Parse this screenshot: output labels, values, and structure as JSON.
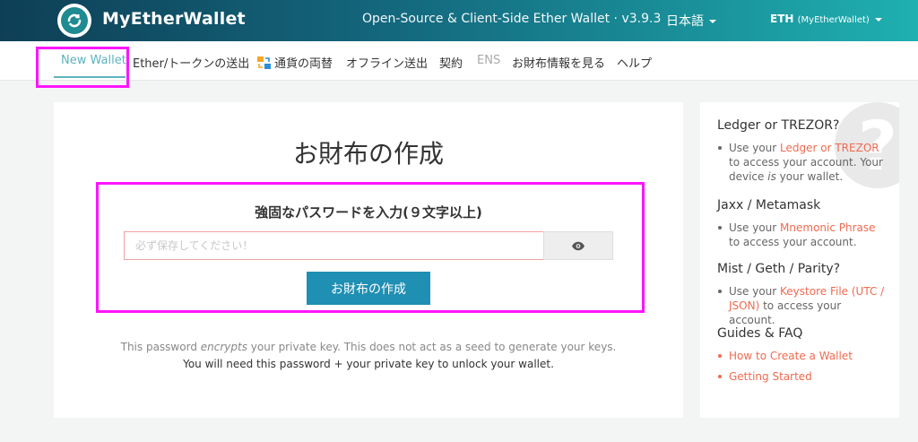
{
  "header": {
    "brand": "MyEtherWallet",
    "tagline": "Open-Source & Client-Side Ether Wallet · v3.9.3",
    "language": "日本語",
    "network_main": "ETH",
    "network_sub": "(MyEtherWallet)"
  },
  "nav": {
    "items": [
      {
        "label": "New Wallet"
      },
      {
        "label": "Ether/トークンの送出"
      },
      {
        "label": "通貨の両替"
      },
      {
        "label": "オフライン送出"
      },
      {
        "label": "契約"
      },
      {
        "label": "ENS"
      },
      {
        "label": "お財布情報を見る"
      },
      {
        "label": "ヘルプ"
      }
    ]
  },
  "main": {
    "title": "お財布の作成",
    "password_label": "強固なパスワードを入力(９文字以上)",
    "password_placeholder": "必ず保存してください！",
    "create_button": "お財布の作成",
    "note_part1": "This password ",
    "note_em": "encrypts",
    "note_part2": " your private key. This does not act as a seed to generate your keys.",
    "note_line2": "You will need this password + your private key to unlock your wallet."
  },
  "sidebar": {
    "sections": [
      {
        "heading": "Ledger or TREZOR?",
        "pre": "Use your ",
        "link": "Ledger or TREZOR",
        "post_a": " to access your account. Your device ",
        "post_em": "is",
        "post_b": " your wallet."
      },
      {
        "heading": "Jaxx / Metamask",
        "pre": "Use your ",
        "link": "Mnemonic Phrase",
        "post": " to access your account."
      },
      {
        "heading": "Mist / Geth / Parity?",
        "pre": "Use your ",
        "link": "Keystore File (UTC / JSON)",
        "post": " to access your account."
      }
    ],
    "guides_heading": "Guides & FAQ",
    "guide_links": [
      "How to Create a Wallet",
      "Getting Started"
    ],
    "qmark": "?"
  },
  "colors": {
    "accent": "#5db2bf",
    "button": "#1f8fb3",
    "link": "#f06a4f",
    "highlight": "#ff14ff"
  }
}
